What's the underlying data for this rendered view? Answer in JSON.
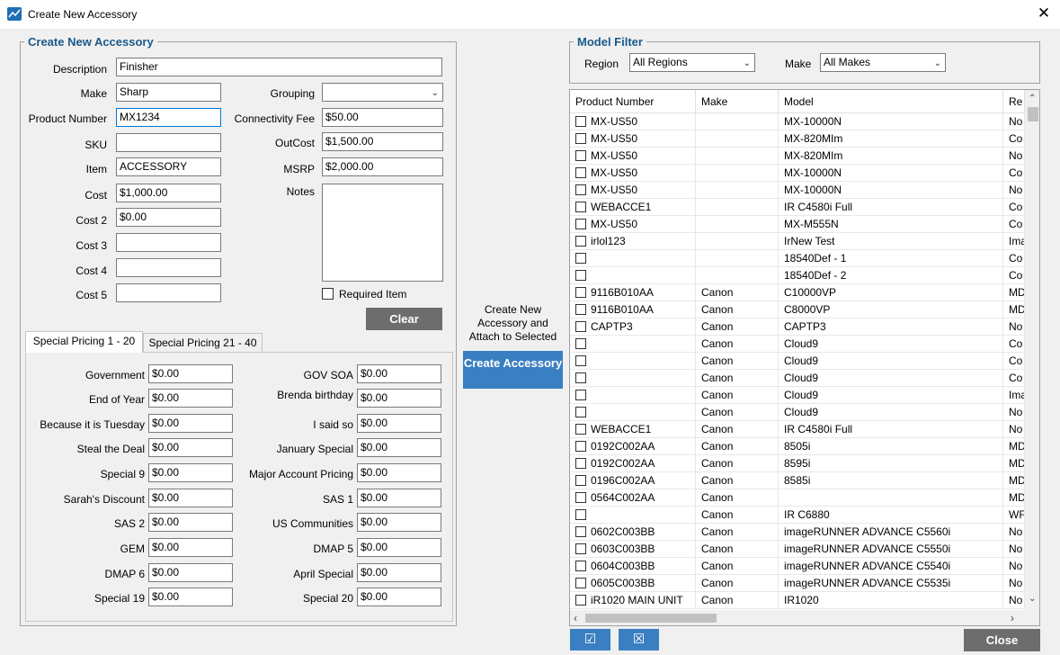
{
  "window": {
    "title": "Create New Accessory",
    "close_glyph": "✕",
    "icon": "app-chart-icon"
  },
  "left": {
    "legend": "Create New Accessory",
    "fields": {
      "description": {
        "label": "Description",
        "value": "Finisher"
      },
      "make": {
        "label": "Make",
        "value": "Sharp"
      },
      "product_number": {
        "label": "Product Number",
        "value": "MX1234"
      },
      "sku": {
        "label": "SKU",
        "value": ""
      },
      "item": {
        "label": "Item",
        "value": "ACCESSORY"
      },
      "cost": {
        "label": "Cost",
        "value": "$1,000.00"
      },
      "cost2": {
        "label": "Cost 2",
        "value": "$0.00"
      },
      "cost3": {
        "label": "Cost 3",
        "value": ""
      },
      "cost4": {
        "label": "Cost 4",
        "value": ""
      },
      "cost5": {
        "label": "Cost 5",
        "value": ""
      },
      "grouping": {
        "label": "Grouping",
        "value": ""
      },
      "connectivity_fee": {
        "label": "Connectivity Fee",
        "value": "$50.00"
      },
      "outcost": {
        "label": "OutCost",
        "value": "$1,500.00"
      },
      "msrp": {
        "label": "MSRP",
        "value": "$2,000.00"
      },
      "notes": {
        "label": "Notes",
        "value": ""
      }
    },
    "required_item_label": "Required Item",
    "clear_label": "Clear",
    "tabs": [
      "Special Pricing 1 - 20",
      "Special Pricing 21 - 40"
    ],
    "pricing_left": [
      {
        "label": "Government",
        "value": "$0.00"
      },
      {
        "label": "End of Year",
        "value": "$0.00"
      },
      {
        "label": "Because it is Tuesday",
        "value": "$0.00"
      },
      {
        "label": "Steal the Deal",
        "value": "$0.00"
      },
      {
        "label": "Special 9",
        "value": "$0.00"
      },
      {
        "label": "Sarah's Discount",
        "value": "$0.00"
      },
      {
        "label": "SAS 2",
        "value": "$0.00"
      },
      {
        "label": "GEM",
        "value": "$0.00"
      },
      {
        "label": "DMAP 6",
        "value": "$0.00"
      },
      {
        "label": "Special 19",
        "value": "$0.00"
      }
    ],
    "pricing_right": [
      {
        "label": "GOV SOA",
        "value": "$0.00"
      },
      {
        "label": "Brenda birthday",
        "value": "$0.00"
      },
      {
        "label": "I said so",
        "value": "$0.00"
      },
      {
        "label": "January Special",
        "value": "$0.00"
      },
      {
        "label": "Major Account Pricing",
        "value": "$0.00"
      },
      {
        "label": "SAS 1",
        "value": "$0.00"
      },
      {
        "label": "US Communities",
        "value": "$0.00"
      },
      {
        "label": "DMAP 5",
        "value": "$0.00"
      },
      {
        "label": "April Special",
        "value": "$0.00"
      },
      {
        "label": "Special 20",
        "value": "$0.00"
      }
    ]
  },
  "middle": {
    "caption": "Create New Accessory and Attach to Selected",
    "create_label": "Create Accessory"
  },
  "right": {
    "legend": "Model Filter",
    "region_label": "Region",
    "region_value": "All Regions",
    "make_label": "Make",
    "make_value": "All Makes",
    "columns": [
      "Product Number",
      "Make",
      "Model",
      "Re"
    ],
    "rows": [
      [
        "MX-US50",
        "",
        "MX-10000N",
        "No"
      ],
      [
        "MX-US50",
        "",
        "MX-820MIm",
        "Co"
      ],
      [
        "MX-US50",
        "",
        "MX-820MIm",
        "No"
      ],
      [
        "MX-US50",
        "",
        "MX-10000N",
        "Co"
      ],
      [
        "MX-US50",
        "",
        "MX-10000N",
        "No"
      ],
      [
        "WEBACCE1",
        "",
        "IR C4580i Full",
        "Co"
      ],
      [
        "MX-US50",
        "",
        "MX-M555N",
        "Co"
      ],
      [
        "irlol123",
        "",
        "IrNew Test",
        "Ima"
      ],
      [
        "",
        "",
        "18540Def - 1",
        "Co"
      ],
      [
        "",
        "",
        "18540Def - 2",
        "Co"
      ],
      [
        "9116B010AA",
        "Canon",
        "C10000VP",
        "MD"
      ],
      [
        "9116B010AA",
        "Canon",
        "C8000VP",
        "MD"
      ],
      [
        "CAPTP3",
        "Canon",
        "CAPTP3",
        "No"
      ],
      [
        "",
        "Canon",
        "Cloud9",
        "Co"
      ],
      [
        "",
        "Canon",
        "Cloud9",
        "Co"
      ],
      [
        "",
        "Canon",
        "Cloud9",
        "Co"
      ],
      [
        "",
        "Canon",
        "Cloud9",
        "Ima"
      ],
      [
        "",
        "Canon",
        "Cloud9",
        "No"
      ],
      [
        "WEBACCE1",
        "Canon",
        "IR C4580i Full",
        "No"
      ],
      [
        "0192C002AA",
        "Canon",
        "8505i",
        "MD"
      ],
      [
        "0192C002AA",
        "Canon",
        "8595i",
        "MD"
      ],
      [
        "0196C002AA",
        "Canon",
        "8585i",
        "MD"
      ],
      [
        "0564C002AA",
        "Canon",
        "",
        "MD"
      ],
      [
        "",
        "Canon",
        "IR C6880",
        "WF"
      ],
      [
        "0602C003BB",
        "Canon",
        "imageRUNNER ADVANCE C5560i",
        "No"
      ],
      [
        "0603C003BB",
        "Canon",
        "imageRUNNER ADVANCE C5550i",
        "No"
      ],
      [
        "0604C003BB",
        "Canon",
        "imageRUNNER ADVANCE C5540i",
        "No"
      ],
      [
        "0605C003BB",
        "Canon",
        "imageRUNNER ADVANCE C5535i",
        "No"
      ],
      [
        "iR1020 MAIN UNIT",
        "Canon",
        "IR1020",
        "No"
      ]
    ],
    "select_all_glyph": "☑",
    "deselect_all_glyph": "☒",
    "close_label": "Close"
  }
}
